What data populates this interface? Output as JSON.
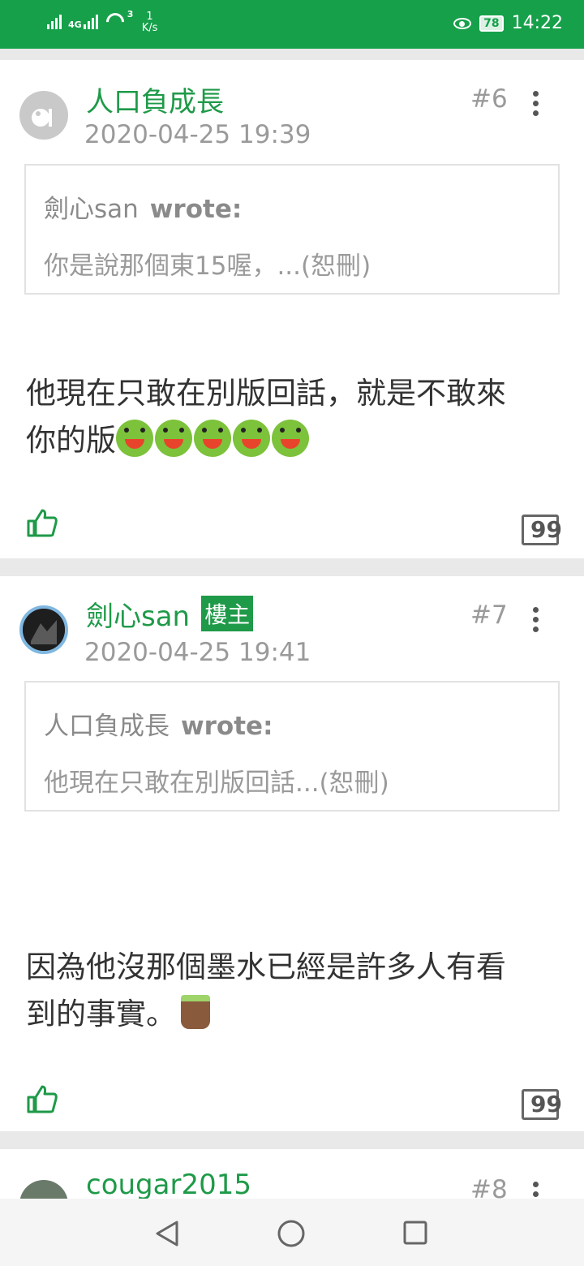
{
  "status_bar": {
    "network": "4G",
    "data_count": "3",
    "speed_value": "1",
    "speed_unit": "K/s",
    "battery": "78",
    "time": "14:22"
  },
  "posts": [
    {
      "username": "人口負成長",
      "floor": "#6",
      "date": "2020-04-25 19:39",
      "quote_author": "劍心san",
      "quote_wrote": "wrote:",
      "quote_text": "你是說那個東15喔，...(恕刪)",
      "content_line1": "他現在只敢在別版回話，就是不敢來",
      "content_line2": "你的版"
    },
    {
      "username": "劍心san",
      "badge": "樓主",
      "floor": "#7",
      "date": "2020-04-25 19:41",
      "quote_author": "人口負成長",
      "quote_wrote": "wrote:",
      "quote_text": "他現在只敢在別版回話...(恕刪)",
      "content_line1": "因為他沒那個墨水已經是許多人有看",
      "content_line2": "到的事實。"
    },
    {
      "username": "cougar2015",
      "floor": "#8"
    }
  ],
  "icons": {
    "like": "thumbs-up-icon",
    "reply": "quote-reply-icon",
    "more": "more-vertical-icon",
    "back": "back-triangle-icon",
    "home": "home-circle-icon",
    "recents": "recents-square-icon"
  },
  "colors": {
    "accent": "#1e9a48",
    "status_bar": "#16a04a"
  }
}
